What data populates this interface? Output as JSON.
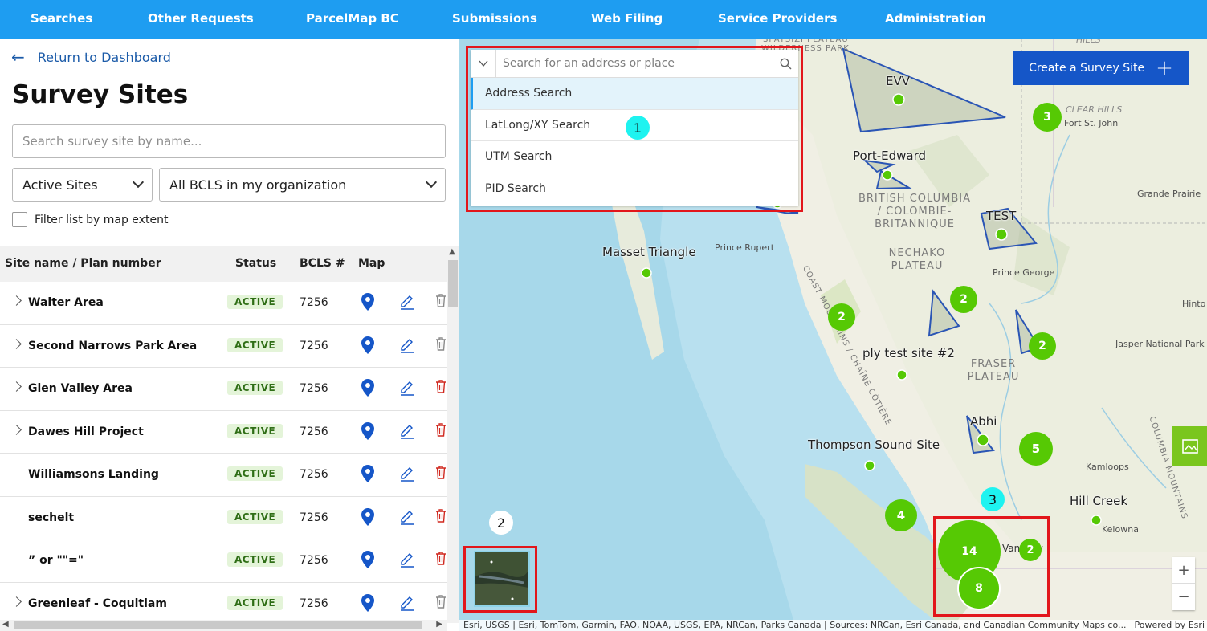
{
  "nav": {
    "items": [
      "Searches",
      "Other Requests",
      "ParcelMap BC",
      "Submissions",
      "Web Filing",
      "Service Providers",
      "Administration"
    ]
  },
  "left": {
    "back_label": "Return to Dashboard",
    "title": "Survey Sites",
    "search_placeholder": "Search survey site by name...",
    "status_filter": "Active Sites",
    "org_filter": "All BCLS in my organization",
    "extent_filter_label": "Filter list by map extent",
    "columns": {
      "name": "Site name / Plan number",
      "status": "Status",
      "bcls": "BCLS #",
      "map": "Map"
    },
    "rows": [
      {
        "name": "Walter Area",
        "status": "ACTIVE",
        "bcls": "7256",
        "expandable": true
      },
      {
        "name": "Second Narrows Park Area",
        "status": "ACTIVE",
        "bcls": "7256",
        "expandable": true
      },
      {
        "name": "Glen Valley Area",
        "status": "ACTIVE",
        "bcls": "7256",
        "expandable": true
      },
      {
        "name": "Dawes Hill Project",
        "status": "ACTIVE",
        "bcls": "7256",
        "expandable": true
      },
      {
        "name": "Williamsons Landing",
        "status": "ACTIVE",
        "bcls": "7256",
        "expandable": false
      },
      {
        "name": "sechelt",
        "status": "ACTIVE",
        "bcls": "7256",
        "expandable": false
      },
      {
        "name": "” or \"\"=\"",
        "status": "ACTIVE",
        "bcls": "7256",
        "expandable": false
      },
      {
        "name": "Greenleaf - Coquitlam",
        "status": "ACTIVE",
        "bcls": "7256",
        "expandable": true
      }
    ]
  },
  "map": {
    "create_button": "Create a Survey Site",
    "search_placeholder": "Search for an address or place",
    "search_options": [
      "Address Search",
      "LatLong/XY Search",
      "UTM Search",
      "PID Search"
    ],
    "annotations": [
      "1",
      "2",
      "3"
    ],
    "site_labels": [
      "EVV",
      "Port-Edward",
      "TEST",
      "Masset Triangle",
      "ply test site #2",
      "Abhi",
      "Thompson Sound Site",
      "Hill Creek"
    ],
    "place_labels": [
      "Fort St. John",
      "Grande Prairie",
      "Prince Rupert",
      "Prince George",
      "Hinto",
      "Jasper National Park",
      "Kamloops",
      "Kelowna",
      "CLEAR HILLS",
      "HILLS",
      "Vancouv"
    ],
    "region_labels": [
      "BRITISH COLUMBIA",
      "/ COLOMBIE-",
      "BRITANNIQUE",
      "NECHAKO",
      "PLATEAU",
      "FRASER",
      "PLATEAU",
      "COAST MOUNTAINS / CHAÎNE CÔTIÈRE",
      "COLUMBIA MOUNTAINS",
      "WILDERNESS PARK",
      "SPATSIZI PLATEAU"
    ],
    "clusters": [
      "3",
      "2",
      "2",
      "2",
      "5",
      "4",
      "14",
      "2",
      "8"
    ],
    "attribution": "Esri, USGS | Esri, TomTom, Garmin, FAO, NOAA, USGS, EPA, NRCan, Parks Canada | Sources: NRCan, Esri Canada, and Canadian Community Maps co...",
    "powered_by": "Powered by Esri",
    "zoom_in": "+",
    "zoom_out": "−",
    "colors": {
      "cluster": "#56c904",
      "polygon_stroke": "#2a55b5",
      "nav": "#1e9df1",
      "create": "#1556c8"
    }
  }
}
